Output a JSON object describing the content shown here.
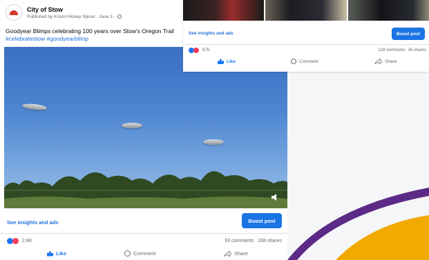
{
  "main_post": {
    "page_name": "City of Stow",
    "logo_text": "Stow",
    "meta": "Published by Kristin Hickey Spicer · June 3 ·",
    "caption": "Goodyear Blimps celebrating 100 years over Stow's Oregon Trail",
    "hashtags": "#celebratestow #goodyearblimp",
    "insights_link": "See insights and ads",
    "boost_label": "Boost post",
    "reaction_count": "2.8K",
    "comments": "63 comments",
    "shares": "338 shares",
    "actions": {
      "like": "Like",
      "comment": "Comment",
      "share": "Share"
    }
  },
  "top_post": {
    "insights_link": "See insights and ads",
    "boost_label": "Boost post",
    "reaction_count": "876",
    "comments": "128 comments",
    "shares": "36 shares",
    "actions": {
      "like": "Like",
      "comment": "Comment",
      "share": "Share"
    }
  },
  "colors": {
    "brand_blue": "#1877f2",
    "link_blue": "#216fdb",
    "decor_purple": "#5b2a86",
    "decor_orange": "#f2a900"
  }
}
